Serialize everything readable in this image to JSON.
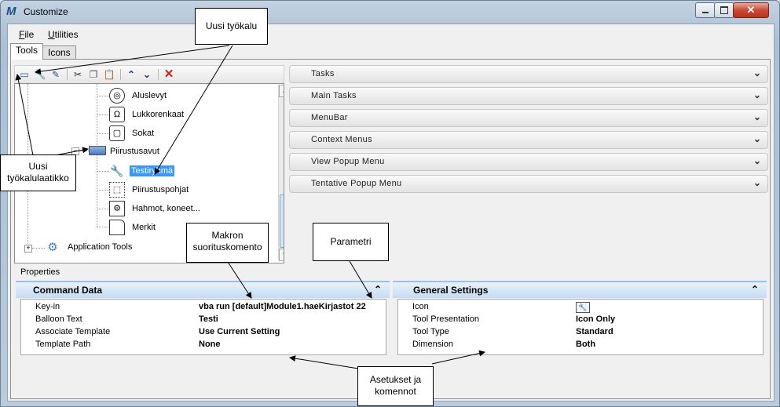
{
  "window": {
    "title": "Customize",
    "close_glyph": "✕",
    "app_icon_letter": "M"
  },
  "menu": [
    {
      "label": "File",
      "accel": "F",
      "rest": "ile"
    },
    {
      "label": "Utilities",
      "accel": "U",
      "rest": "tilities"
    }
  ],
  "tabs": [
    {
      "label": "Tools"
    },
    {
      "label": "Icons"
    }
  ],
  "toolbar_icons": [
    "new-toolbox-icon",
    "new-tool-icon",
    "edit-tool-icon",
    "cut-icon",
    "copy-icon",
    "paste-icon",
    "move-up-icon",
    "move-down-icon",
    "delete-icon"
  ],
  "tree": {
    "items": [
      {
        "label": "Aluslevyt",
        "glyph": "◎"
      },
      {
        "label": "Lukkorenkaat",
        "glyph": "Ω"
      },
      {
        "label": "Sokat",
        "glyph": "▢"
      },
      {
        "label": "Piirustusavut",
        "glyph": ""
      },
      {
        "label": "Testiryhmä",
        "glyph": "🔧"
      },
      {
        "label": "Piirustuspohjat",
        "glyph": "⬚"
      },
      {
        "label": "Hahmot, koneet...",
        "glyph": "⚙"
      },
      {
        "label": "Merkit",
        "glyph": ""
      },
      {
        "label": "Application Tools",
        "glyph": "⚙"
      }
    ]
  },
  "sections": [
    {
      "label": "Tasks"
    },
    {
      "label": "Main Tasks"
    },
    {
      "label": "MenuBar"
    },
    {
      "label": "Context Menus"
    },
    {
      "label": "View Popup Menu"
    },
    {
      "label": "Tentative Popup Menu"
    }
  ],
  "properties": {
    "label": "Properties",
    "command_data": {
      "title": "Command Data",
      "rows": [
        {
          "key": "Key-in",
          "value": "vba run [default]Module1.haeKirjastot 22"
        },
        {
          "key": "Balloon Text",
          "value": "Testi"
        },
        {
          "key": "Associate Template",
          "value": "Use Current Setting"
        },
        {
          "key": "Template Path",
          "value": "None"
        }
      ]
    },
    "general_settings": {
      "title": "General Settings",
      "rows": [
        {
          "key": "Icon",
          "value": ""
        },
        {
          "key": "Tool Presentation",
          "value": "Icon Only"
        },
        {
          "key": "Tool Type",
          "value": "Standard"
        },
        {
          "key": "Dimension",
          "value": "Both"
        }
      ]
    }
  },
  "callouts": {
    "new_tool": "Uusi työkalu",
    "new_toolbox_1": "Uusi",
    "new_toolbox_2": "työkalulaatikko",
    "macro_1": "Makron",
    "macro_2": "suorituskomento",
    "param": "Parametri",
    "settings_1": "Asetukset ja",
    "settings_2": "komennot"
  },
  "colors": {
    "selection": "#3399ff",
    "accent_header": "#c6dcf3",
    "close_button": "#c94a34"
  }
}
